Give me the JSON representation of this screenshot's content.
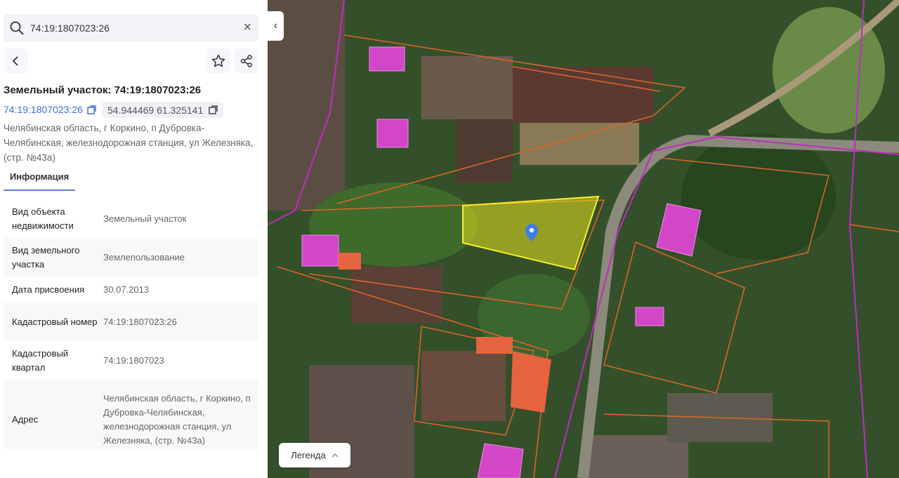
{
  "search": {
    "value": "74:19:1807023:26"
  },
  "object": {
    "title": "Земельный участок: 74:19:1807023:26",
    "cadastral_link": "74:19:1807023:26",
    "coordinates": "54.944469 61.325141",
    "address": "Челябинская область, г Коркино, п Дубровка-Челябинская, железнодорожная станция, ул Железняка, (стр. №43а)"
  },
  "tabs": [
    {
      "label": "Информация",
      "active": true
    }
  ],
  "info": [
    {
      "label": "Вид объекта недвижимости",
      "value": "Земельный участок"
    },
    {
      "label": "Вид земельного участка",
      "value": "Землепользование"
    },
    {
      "label": "Дата присвоения",
      "value": "30.07.2013"
    },
    {
      "label": "Кадастровый номер",
      "value": "74:19:1807023:26"
    },
    {
      "label": "Кадастровый квартал",
      "value": "74:19:1807023"
    },
    {
      "label": "Адрес",
      "value": "Челябинская область, г Коркино, п Дубровка-Челябинская, железнодорожная станция, ул Железняка, (стр. №43а)"
    }
  ],
  "map": {
    "legend_label": "Легенда",
    "parcel_color": "#e6e01e",
    "boundary_color": "#e0652a",
    "road_color": "#c02cc0",
    "link_color": "#3d6fdc"
  }
}
